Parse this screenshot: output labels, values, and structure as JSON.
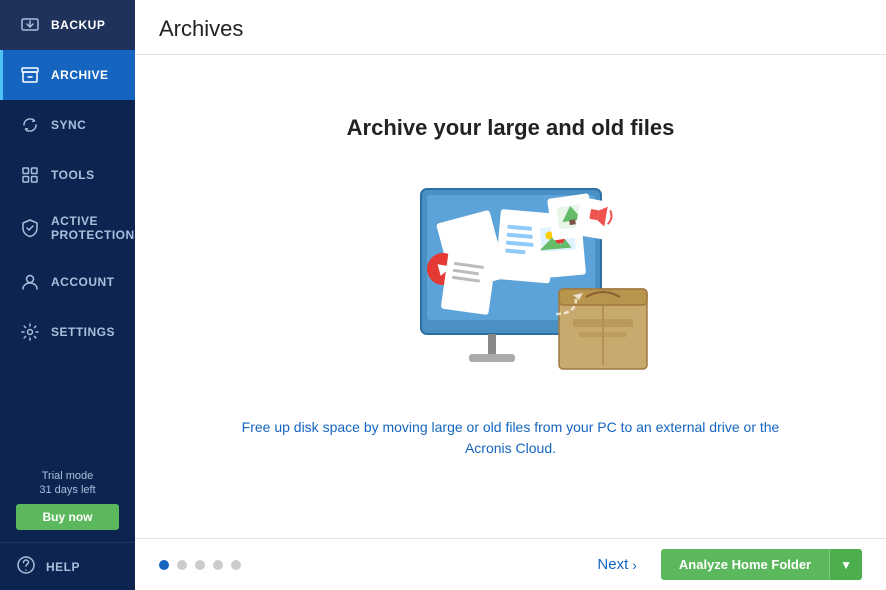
{
  "sidebar": {
    "items": [
      {
        "id": "backup",
        "label": "BACKUP",
        "active": false
      },
      {
        "id": "archive",
        "label": "ARCHIVE",
        "active": true
      },
      {
        "id": "sync",
        "label": "SYNC",
        "active": false
      },
      {
        "id": "tools",
        "label": "TOOLS",
        "active": false
      },
      {
        "id": "active-protection",
        "label": "ACTIVE PROTECTION",
        "active": false
      },
      {
        "id": "account",
        "label": "ACCOUNT",
        "active": false
      },
      {
        "id": "settings",
        "label": "SETTINGS",
        "active": false
      }
    ],
    "help_label": "HELP",
    "trial_mode": "Trial mode",
    "days_left": "31 days left",
    "buy_now": "Buy now"
  },
  "header": {
    "title": "Archives"
  },
  "main": {
    "archive_title": "Archive your large and old files",
    "description": "Free up disk space by moving large or old files from your PC to an external drive or the Acronis Cloud.",
    "next_label": "Next",
    "pagination_count": 5,
    "active_dot": 0,
    "analyze_btn": "Analyze Home Folder"
  },
  "colors": {
    "sidebar_bg": "#0d2350",
    "active_item": "#1565c0",
    "green": "#5cb85c",
    "link_blue": "#1565c0"
  }
}
